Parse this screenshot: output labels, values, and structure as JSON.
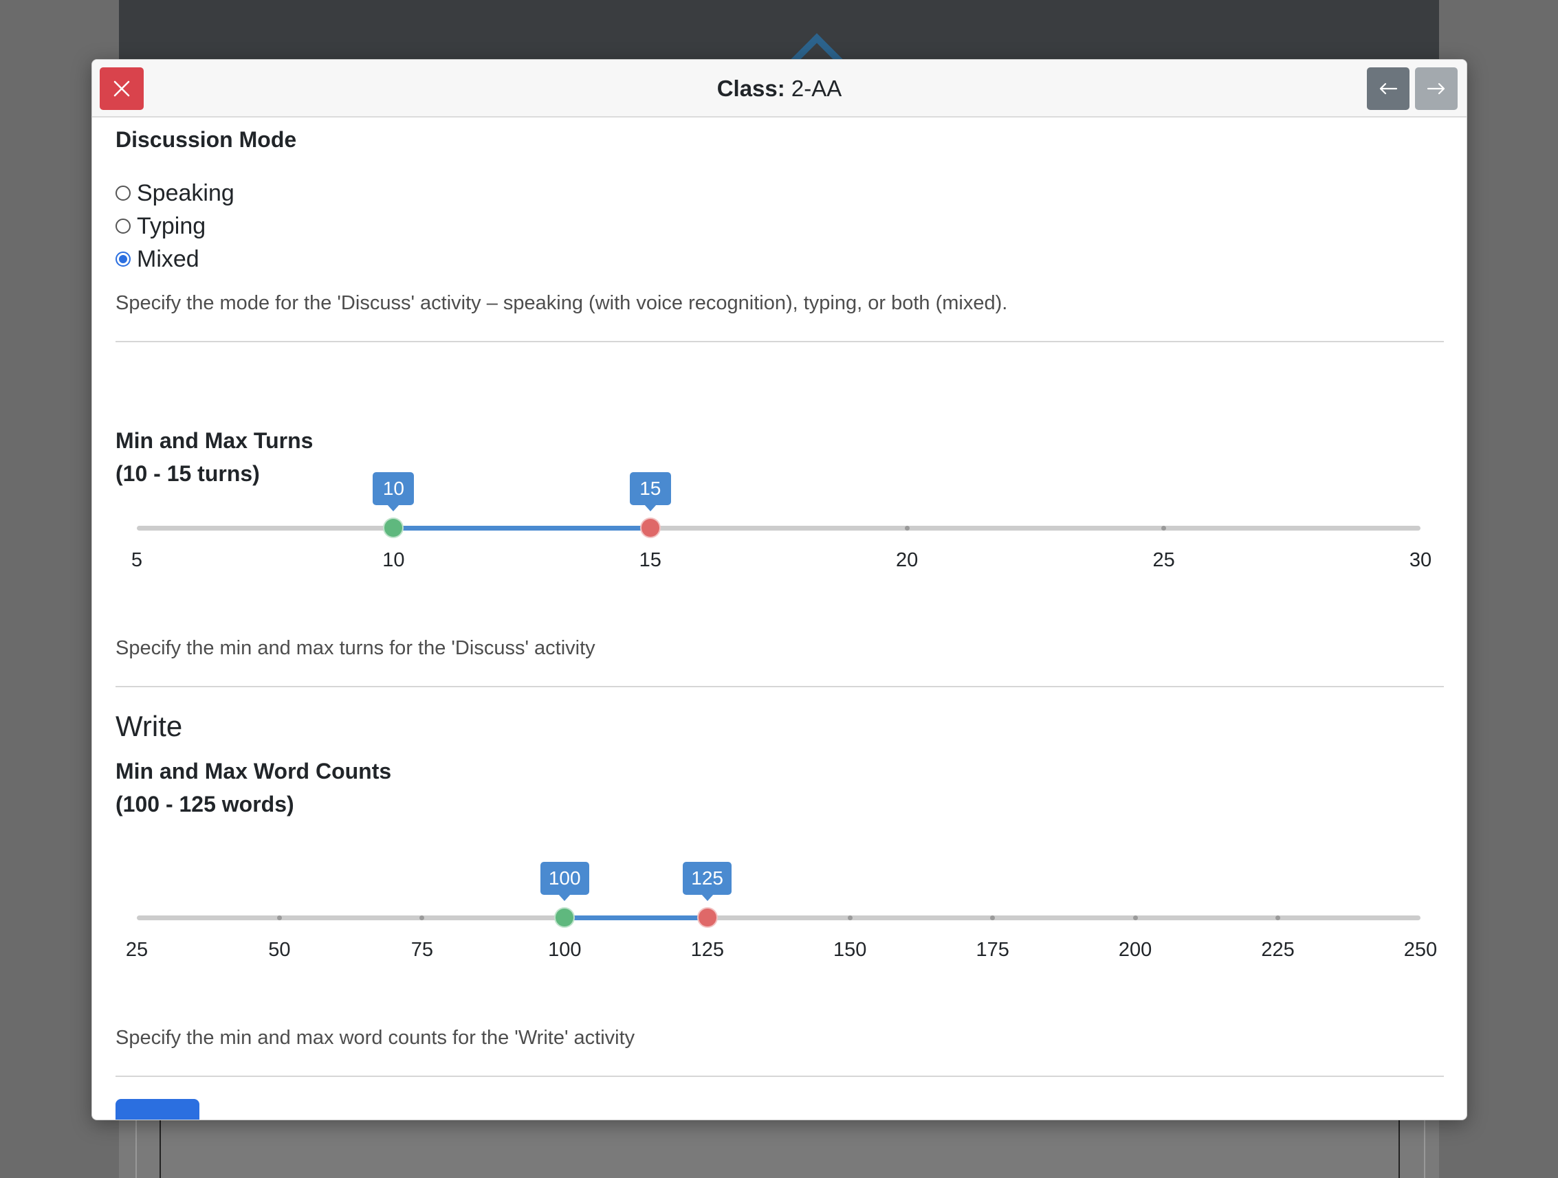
{
  "header": {
    "title_label": "Class:",
    "title_value": "2-AA"
  },
  "discussion_mode": {
    "title": "Discussion Mode",
    "options": [
      "Speaking",
      "Typing",
      "Mixed"
    ],
    "selected": "Mixed",
    "help": "Specify the mode for the 'Discuss' activity – speaking (with voice recognition), typing, or both (mixed)."
  },
  "turns": {
    "title": "Min and Max Turns",
    "summary": "(10 - 15 turns)",
    "min": 5,
    "max": 30,
    "low": 10,
    "high": 15,
    "ticks": [
      "5",
      "10",
      "15",
      "20",
      "25",
      "30"
    ],
    "help": "Specify the min and max turns for the 'Discuss' activity"
  },
  "write": {
    "heading": "Write",
    "title": "Min and Max Word Counts",
    "summary": "(100 - 125 words)",
    "min": 25,
    "max": 250,
    "low": 100,
    "high": 125,
    "ticks": [
      "25",
      "50",
      "75",
      "100",
      "125",
      "150",
      "175",
      "200",
      "225",
      "250"
    ],
    "help": "Specify the min and max word counts for the 'Write' activity"
  },
  "icons": {
    "close": "close-icon",
    "prev": "arrow-left-icon",
    "next": "arrow-right-icon"
  },
  "colors": {
    "close_button": "#d9434c",
    "range_fill": "#4a8ad0",
    "handle_min": "#5fb87e",
    "handle_max": "#df6868",
    "primary": "#2b6fe0"
  }
}
